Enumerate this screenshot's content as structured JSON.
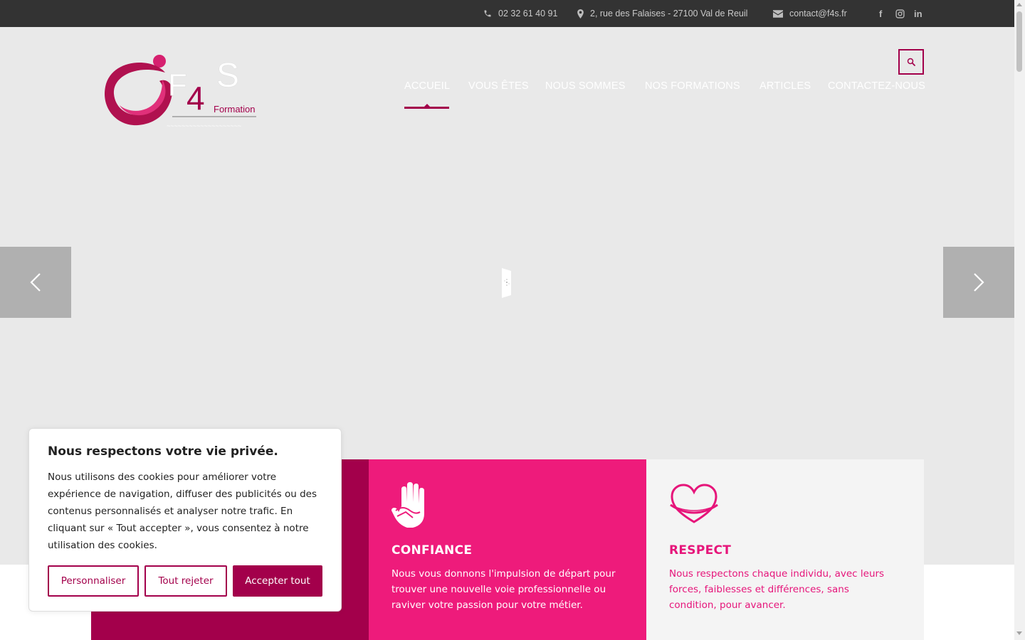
{
  "topbar": {
    "phone": "02 32 61 40 91",
    "address": "2, rue des Falaises - 27100 Val de Reuil",
    "email": "contact@f4s.fr",
    "social": [
      "facebook-icon",
      "instagram-icon",
      "linkedin-icon"
    ]
  },
  "header": {
    "logo_text": "F4S",
    "logo_sub": "Formation",
    "nav": [
      "ACCUEIL",
      "VOUS ÊTES",
      "NOUS SOMMES",
      "NOS FORMATIONS",
      "ARTICLES",
      "CONTACTEZ-NOUS"
    ],
    "active": "ACCUEIL"
  },
  "features": [
    {
      "title": "",
      "text": "",
      "color": "#a3004b"
    },
    {
      "title": "CONFIANCE",
      "text": "Nous vous donnons l'impulsion de départ pour trouver une nouvelle voie professionnelle ou raviver votre passion pour votre métier.",
      "color": "#ee1b7b",
      "icon": "hands-icon"
    },
    {
      "title": "RESPECT",
      "text": "Nous respectons chaque individu, avec leurs forces, faiblesses et différences, sans condition, pour avancer.",
      "color": "#f4f4f4",
      "icon": "heart-icon"
    }
  ],
  "cookie": {
    "title": "Nous respectons votre vie privée.",
    "text": "Nous utilisons des cookies pour améliorer votre expérience de navigation, diffuser des publicités ou des contenus personnalisés et analyser notre trafic. En cliquant sur « Tout accepter », vous consentez à notre utilisation des cookies.",
    "btn_customize": "Personnaliser",
    "btn_reject": "Tout rejeter",
    "btn_accept": "Accepter tout"
  },
  "colors": {
    "brand_dark": "#a3004b",
    "brand_pink": "#ee1b7b",
    "topbar": "#333333"
  }
}
